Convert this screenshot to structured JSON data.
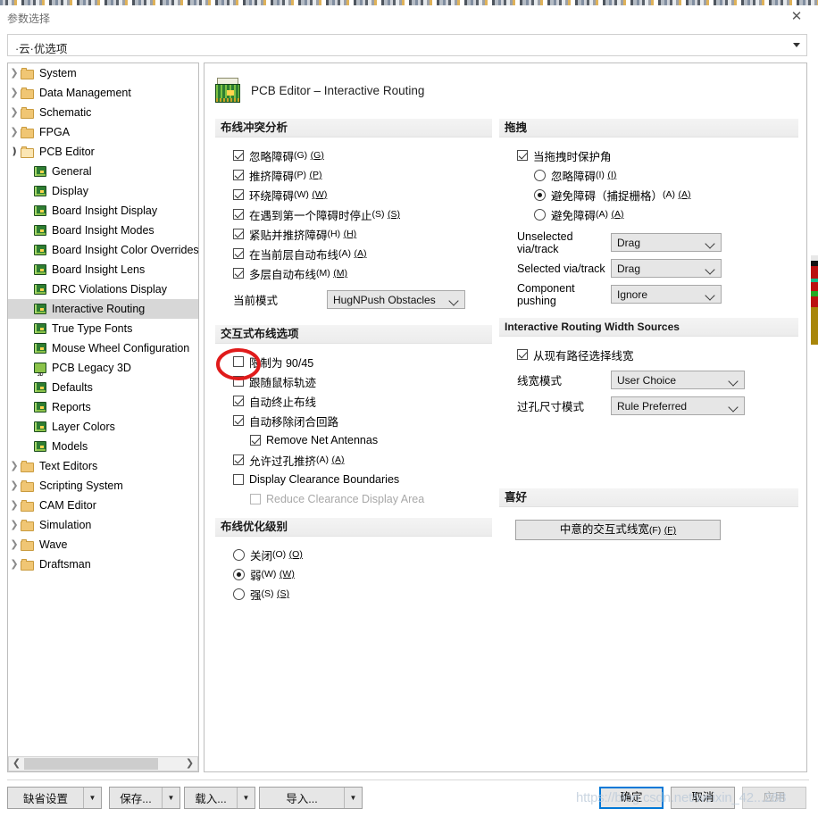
{
  "window": {
    "title": "参数选择",
    "close_icon": "close-icon",
    "profile_combo": {
      "value": "·云·优选项",
      "chevron_icon": "chevron-down-icon"
    }
  },
  "tree": {
    "nodes": [
      {
        "label": "System",
        "icon": "folder-icon",
        "depth": 0,
        "expander": "collapsed",
        "selected": false
      },
      {
        "label": "Data Management",
        "icon": "folder-icon",
        "depth": 0,
        "expander": "collapsed",
        "selected": false
      },
      {
        "label": "Schematic",
        "icon": "folder-icon",
        "depth": 0,
        "expander": "collapsed",
        "selected": false
      },
      {
        "label": "FPGA",
        "icon": "folder-icon",
        "depth": 0,
        "expander": "collapsed",
        "selected": false
      },
      {
        "label": "PCB Editor",
        "icon": "folder-open-icon",
        "depth": 0,
        "expander": "expanded",
        "selected": false
      },
      {
        "label": "General",
        "icon": "pcb-icon",
        "depth": 1,
        "expander": "none",
        "selected": false
      },
      {
        "label": "Display",
        "icon": "pcb-icon",
        "depth": 1,
        "expander": "none",
        "selected": false
      },
      {
        "label": "Board Insight Display",
        "icon": "pcb-icon",
        "depth": 1,
        "expander": "none",
        "selected": false
      },
      {
        "label": "Board Insight Modes",
        "icon": "pcb-icon",
        "depth": 1,
        "expander": "none",
        "selected": false
      },
      {
        "label": "Board Insight Color Overrides",
        "icon": "pcb-icon",
        "depth": 1,
        "expander": "none",
        "selected": false
      },
      {
        "label": "Board Insight Lens",
        "icon": "pcb-icon",
        "depth": 1,
        "expander": "none",
        "selected": false
      },
      {
        "label": "DRC Violations Display",
        "icon": "pcb-icon",
        "depth": 1,
        "expander": "none",
        "selected": false
      },
      {
        "label": "Interactive Routing",
        "icon": "pcb-icon",
        "depth": 1,
        "expander": "none",
        "selected": true
      },
      {
        "label": "True Type Fonts",
        "icon": "pcb-icon",
        "depth": 1,
        "expander": "none",
        "selected": false
      },
      {
        "label": "Mouse Wheel Configuration",
        "icon": "pcb-icon",
        "depth": 1,
        "expander": "none",
        "selected": false
      },
      {
        "label": "PCB Legacy 3D",
        "icon": "pcb-3d-icon",
        "depth": 1,
        "expander": "none",
        "selected": false
      },
      {
        "label": "Defaults",
        "icon": "pcb-icon",
        "depth": 1,
        "expander": "none",
        "selected": false
      },
      {
        "label": "Reports",
        "icon": "pcb-icon",
        "depth": 1,
        "expander": "none",
        "selected": false
      },
      {
        "label": "Layer Colors",
        "icon": "pcb-icon",
        "depth": 1,
        "expander": "none",
        "selected": false
      },
      {
        "label": "Models",
        "icon": "pcb-icon",
        "depth": 1,
        "expander": "none",
        "selected": false
      },
      {
        "label": "Text Editors",
        "icon": "folder-icon",
        "depth": 0,
        "expander": "collapsed",
        "selected": false
      },
      {
        "label": "Scripting System",
        "icon": "folder-icon",
        "depth": 0,
        "expander": "collapsed",
        "selected": false
      },
      {
        "label": "CAM Editor",
        "icon": "folder-icon",
        "depth": 0,
        "expander": "collapsed",
        "selected": false
      },
      {
        "label": "Simulation",
        "icon": "folder-icon",
        "depth": 0,
        "expander": "collapsed",
        "selected": false
      },
      {
        "label": "Wave",
        "icon": "folder-icon",
        "depth": 0,
        "expander": "collapsed",
        "selected": false
      },
      {
        "label": "Draftsman",
        "icon": "folder-icon",
        "depth": 0,
        "expander": "collapsed",
        "selected": false
      }
    ],
    "scrollbar": {
      "left_arrow": "❮",
      "right_arrow": "❯"
    }
  },
  "page": {
    "icon": "pcb-board-icon",
    "title": "PCB Editor – Interactive Routing"
  },
  "sections": {
    "routing_conflict": {
      "header": "布线冲突分析",
      "items": [
        {
          "label": "忽略障碍",
          "acc": "(G)",
          "acc_u": "(G)",
          "checked": true
        },
        {
          "label": "推挤障碍",
          "acc": "(P)",
          "acc_u": "(P)",
          "checked": true
        },
        {
          "label": "环绕障碍",
          "acc": "(W)",
          "acc_u": "(W)",
          "checked": true
        },
        {
          "label": "在遇到第一个障碍时停止",
          "acc": "(S)",
          "acc_u": "(S)",
          "checked": true
        },
        {
          "label": "紧贴并推挤障碍",
          "acc": "(H)",
          "acc_u": "(H)",
          "checked": true
        },
        {
          "label": "在当前层自动布线",
          "acc": "(A)",
          "acc_u": "(A)",
          "checked": true
        },
        {
          "label": "多层自动布线",
          "acc": "(M)",
          "acc_u": "(M)",
          "checked": true
        }
      ],
      "mode_label": "当前模式",
      "mode_value": "HugNPush Obstacles"
    },
    "interactive_options": {
      "header": "交互式布线选项",
      "items": [
        {
          "label": "限制为 90/45",
          "acc": "",
          "acc_u": "",
          "checked": false,
          "indent": false,
          "disabled": false,
          "annotated": true
        },
        {
          "label": "跟随鼠标轨迹",
          "acc": "",
          "acc_u": "",
          "checked": false,
          "indent": false,
          "disabled": false
        },
        {
          "label": "自动终止布线",
          "acc": "",
          "acc_u": "",
          "checked": true,
          "indent": false,
          "disabled": false
        },
        {
          "label": "自动移除闭合回路",
          "acc": "",
          "acc_u": "",
          "checked": true,
          "indent": false,
          "disabled": false
        },
        {
          "label": "Remove Net Antennas",
          "acc": "",
          "acc_u": "",
          "checked": true,
          "indent": true,
          "disabled": false
        },
        {
          "label": "允许过孔推挤",
          "acc": "(A)",
          "acc_u": "(A)",
          "checked": true,
          "indent": false,
          "disabled": false
        },
        {
          "label": "Display Clearance Boundaries",
          "acc": "",
          "acc_u": "",
          "checked": false,
          "indent": false,
          "disabled": false
        },
        {
          "label": "Reduce Clearance Display Area",
          "acc": "",
          "acc_u": "",
          "checked": false,
          "indent": true,
          "disabled": true
        }
      ]
    },
    "optimization": {
      "header": "布线优化级别",
      "items": [
        {
          "label": "关闭",
          "acc": "(O)",
          "acc_u": "(O)",
          "selected": false
        },
        {
          "label": "弱",
          "acc": "(W)",
          "acc_u": "(W)",
          "selected": true
        },
        {
          "label": "强",
          "acc": "(S)",
          "acc_u": "(S)",
          "selected": false
        }
      ]
    },
    "dragging": {
      "header": "拖拽",
      "protect_angle": {
        "label": "当拖拽时保护角",
        "checked": true
      },
      "radios": [
        {
          "label": "忽略障碍",
          "acc": "(I)",
          "acc_u": "(I)",
          "selected": false
        },
        {
          "label": "避免障碍（捕捉栅格）",
          "acc": "(A)",
          "acc_u": "(A)",
          "selected": true
        },
        {
          "label": "避免障碍",
          "acc": "(A)",
          "acc_u": "(A)",
          "selected": false
        }
      ],
      "dropdowns": [
        {
          "label": "Unselected via/track",
          "value": "Drag"
        },
        {
          "label": "Selected via/track",
          "value": "Drag"
        },
        {
          "label": "Component pushing",
          "value": "Ignore"
        }
      ]
    },
    "width_sources": {
      "header": "Interactive Routing Width Sources",
      "checkbox": {
        "label": "从现有路径选择线宽",
        "checked": true
      },
      "dropdowns": [
        {
          "label": "线宽模式",
          "value": "User Choice"
        },
        {
          "label": "过孔尺寸模式",
          "value": "Rule Preferred"
        }
      ]
    },
    "favorites": {
      "header": "喜好",
      "button": {
        "label": "中意的交互式线宽",
        "acc": "(F)",
        "acc_u": "(F)"
      }
    }
  },
  "footer": {
    "split_buttons": [
      {
        "label": "缺省设置",
        "dropdown_icon": "chevron-down-icon"
      },
      {
        "label": "保存...",
        "dropdown_icon": "chevron-down-icon"
      },
      {
        "label": "载入...",
        "dropdown_icon": "chevron-down-icon"
      },
      {
        "label": "导入...",
        "dropdown_icon": "chevron-down-icon"
      }
    ],
    "ok": "确定",
    "cancel": "取消",
    "apply": "应用"
  },
  "annotation": {
    "circle_color": "#e01b1b"
  },
  "watermark": "https://blog.csdn.net/weixin_42...288"
}
